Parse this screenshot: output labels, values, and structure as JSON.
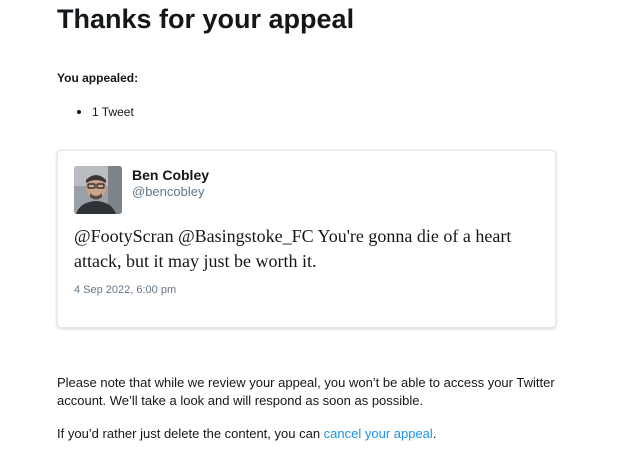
{
  "page": {
    "title": "Thanks for your appeal"
  },
  "appeal_summary": {
    "label": "You appealed:",
    "items": [
      "1 Tweet"
    ]
  },
  "tweet": {
    "author_name": "Ben Cobley",
    "author_handle": "@bencobley",
    "avatar_icon": "user-photo-avatar",
    "text": "@FootyScran @Basingstoke_FC You're gonna die of a heart attack, but it may just be worth it.",
    "timestamp": "4 Sep 2022, 6:00 pm"
  },
  "notice": {
    "review_text": "Please note that while we review your appeal, you won’t be able to access your Twitter account. We’ll take a look and will respond as soon as possible.",
    "delete_prefix": "If you’d rather just delete the content, you can ",
    "cancel_link_text": "cancel your appeal",
    "delete_suffix": "."
  },
  "colors": {
    "text_primary": "#14171a",
    "text_secondary": "#657786",
    "link": "#1b95e0",
    "card_border": "#e1e8ed"
  }
}
